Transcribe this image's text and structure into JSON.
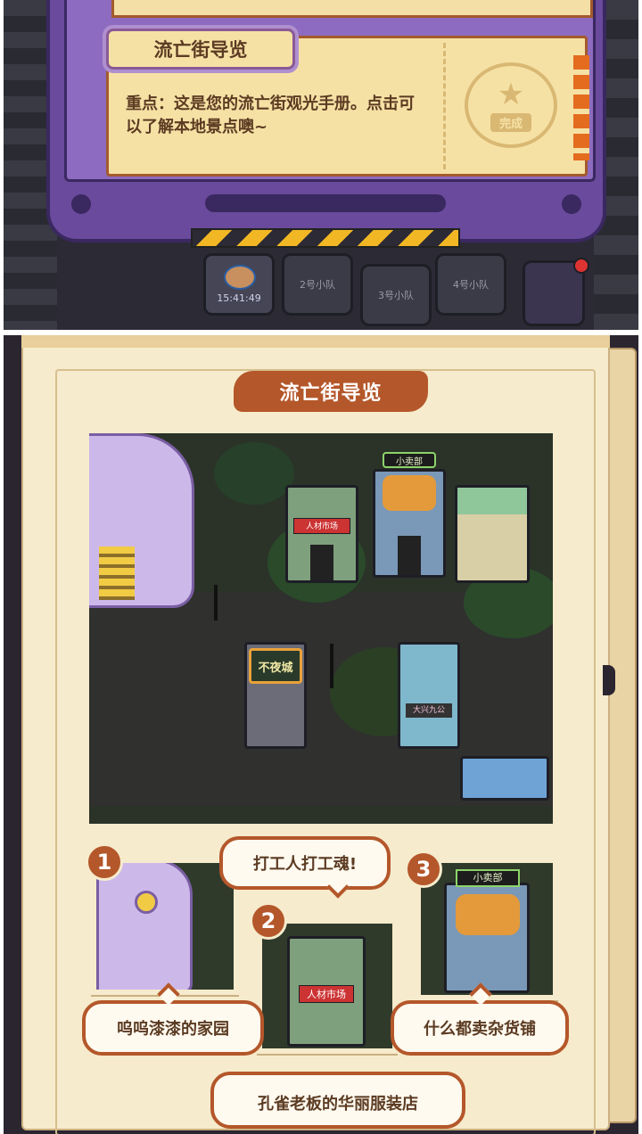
{
  "top_panel": {
    "ticket_title": "流亡街导览",
    "ticket_body": "重点：这是您的流亡街观光手册。点击可以了解本地景点噢~",
    "stamp_label": "完成",
    "squads": [
      {
        "label": "",
        "timer": "15:41:49"
      },
      {
        "label": "2号小队",
        "timer": ""
      },
      {
        "label": "3号小队",
        "timer": ""
      },
      {
        "label": "4号小队",
        "timer": ""
      }
    ]
  },
  "bottom_panel": {
    "banner_title": "流亡街导览",
    "map_signs": {
      "talent_market": "人材市场",
      "general_store": "小卖部",
      "night_city": "不夜城",
      "fashion_store": "大兴九公"
    },
    "spots": [
      {
        "number": "1",
        "caption": "呜呜漆漆的家园"
      },
      {
        "number": "2",
        "caption": "打工人打工魂!",
        "sign": "人材市场"
      },
      {
        "number": "3",
        "caption": "什么都卖杂货铺",
        "sign": "小卖部"
      }
    ],
    "next_caption": "孔雀老板的华丽服装店"
  },
  "colors": {
    "device_purple": "#6a4a9c",
    "paper": "#f6ebcc",
    "accent_brown": "#b4572a",
    "hazard_yellow": "#f2b724"
  }
}
